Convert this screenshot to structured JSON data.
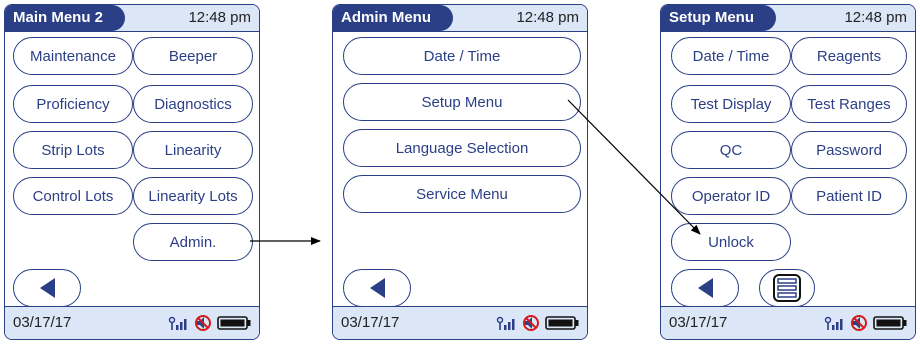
{
  "screens": [
    {
      "title": "Main Menu 2",
      "time": "12:48 pm",
      "buttons": [
        "Maintenance",
        "Beeper",
        "Proficiency",
        "Diagnostics",
        "Strip Lots",
        "Linearity",
        "Control Lots",
        "Linearity Lots",
        "Admin."
      ],
      "date": "03/17/17"
    },
    {
      "title": "Admin Menu",
      "time": "12:48 pm",
      "buttons": [
        "Date / Time",
        "Setup Menu",
        "Language Selection",
        "Service Menu"
      ],
      "date": "03/17/17"
    },
    {
      "title": "Setup Menu",
      "time": "12:48 pm",
      "buttons": [
        "Date / Time",
        "Reagents",
        "Test Display",
        "Test Ranges",
        "QC",
        "Password",
        "Operator ID",
        "Patient ID",
        "Unlock"
      ],
      "date": "03/17/17"
    }
  ],
  "icons": {
    "back": "back-arrow-icon",
    "list": "list-icon",
    "wifi": "wireless-signal-icon",
    "no_sound": "sound-off-icon",
    "battery": "battery-icon"
  },
  "colors": {
    "accent": "#2b3f86",
    "header_bg": "#dbe6f6"
  }
}
